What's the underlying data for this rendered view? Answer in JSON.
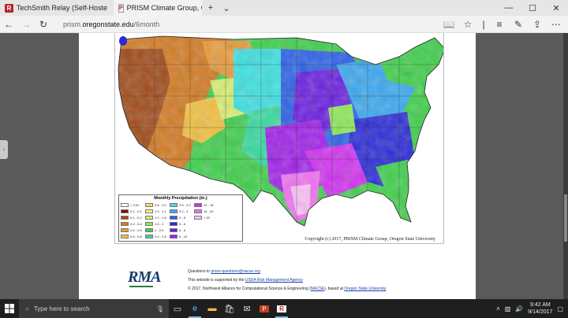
{
  "tabs": [
    {
      "label": "TechSmith Relay (Self-Hoste",
      "favicon": "R"
    },
    {
      "label": "PRISM Climate Group, C",
      "favicon": "P"
    }
  ],
  "address": {
    "prefix": "prism.",
    "domain": "oregonstate.edu",
    "path": "/6month"
  },
  "map": {
    "copyright": "Copyright (c) 2017, PRISM Climate Group, Oregon State University",
    "legend_title": "Monthly Precipitation (in.)",
    "legend": [
      {
        "label": "< 0.01",
        "color": "#ffffff"
      },
      {
        "label": "0.1 - 0.1",
        "color": "#7a1010"
      },
      {
        "label": "0.1 - 0.2",
        "color": "#a04a18"
      },
      {
        "label": "0.2 - 0.4",
        "color": "#d27a22"
      },
      {
        "label": "0.4 - 0.6",
        "color": "#e89a3a"
      },
      {
        "label": "0.6 - 0.8",
        "color": "#f2c040"
      },
      {
        "label": "0.8 - 1.0",
        "color": "#f5e050"
      },
      {
        "label": "1.0 - 1.2",
        "color": "#fff27a"
      },
      {
        "label": "1.2 - 1.6",
        "color": "#d8f070"
      },
      {
        "label": "1.6 - 2",
        "color": "#8ee858"
      },
      {
        "label": "2 - 2.4",
        "color": "#3ecf4a"
      },
      {
        "label": "2.4 - 2.8",
        "color": "#38d8a0"
      },
      {
        "label": "2.8 - 3.2",
        "color": "#3ce0e0"
      },
      {
        "label": "3.2 - 4",
        "color": "#3aa8f0"
      },
      {
        "label": "4 - 5",
        "color": "#2a60e8"
      },
      {
        "label": "5 - 6",
        "color": "#2a2ad8"
      },
      {
        "label": "6 - 8",
        "color": "#6a1ee0"
      },
      {
        "label": "8 - 12",
        "color": "#a020e8"
      },
      {
        "label": "12 - 16",
        "color": "#d030f0"
      },
      {
        "label": "16 - 20",
        "color": "#f070f0"
      },
      {
        "label": "> 20",
        "color": "#fcc0f8"
      }
    ]
  },
  "footer": {
    "questions_prefix": "Questions to ",
    "questions_link": "prism-questions@nacse.org",
    "support_prefix": "This website is supported by the ",
    "support_link": "USDA Risk Management Agency",
    "copy_prefix": "© 2017, Northwest Alliance for Computational Science & Engineering (",
    "copy_link1": "NACSE",
    "copy_mid": "), based at ",
    "copy_link2": "Oregon State University",
    "logo": "RMA"
  },
  "taskbar": {
    "search_placeholder": "Type here to search",
    "time": "9:42 AM",
    "date": "9/14/2017"
  }
}
